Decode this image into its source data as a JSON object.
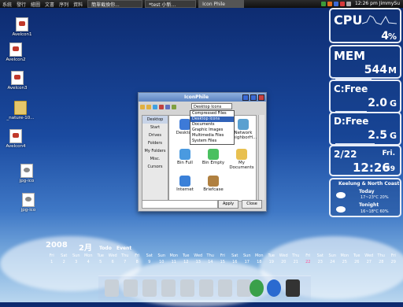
{
  "taskbar": {
    "menus": [
      "系統",
      "發行",
      "繪圖",
      "文書",
      "序列",
      "資料"
    ],
    "tasks": [
      "簡單截換你...",
      "*test 小新...",
      "Icon Phile"
    ],
    "clock": "12:26 pm JimmySu"
  },
  "desktop_icons": [
    "AveIcon1",
    "AveIcon2",
    "AveIcon3",
    "_nature-10...",
    "AveIcon4",
    "jpg-ico",
    "jpg-ico"
  ],
  "widgets": {
    "cpu": {
      "label": "CPU",
      "value": "4",
      "unit": "%"
    },
    "mem": {
      "label": "MEM",
      "value": "544",
      "unit": "M"
    },
    "c_free": {
      "label": "C:Free",
      "value": "2.0",
      "unit": "G"
    },
    "d_free": {
      "label": "D:Free",
      "value": "2.5",
      "unit": "G"
    },
    "date": {
      "date": "2/22",
      "weekday": "Fri.",
      "time": "12:26",
      "seconds": "59"
    },
    "weather": {
      "location": "Keelung & North Coast",
      "today_label": "Today",
      "today_temp": "17~23°C 20%",
      "tonight_label": "Tonight",
      "tonight_temp": "16~18°C 60%"
    }
  },
  "window": {
    "title": "IconPhile",
    "dropdown_value": "Desktop Icons",
    "menu_items": [
      "Compressed Files",
      "Desktop Icons",
      "Documents",
      "Graphic Images",
      "Multimedia Files",
      "System Files"
    ],
    "sidebar": [
      "Desktop",
      "Start",
      "Drives",
      "Folders",
      "My Folders",
      "Misc.",
      "Cursors"
    ],
    "files": [
      "Desktop",
      "Network NeighborH...",
      "Bin Full",
      "Bin Empty",
      "My Documents",
      "Internet",
      "Briefcase"
    ],
    "apply_label": "Apply",
    "close_label": "Close"
  },
  "calendar": {
    "year": "2008",
    "month": "2月",
    "todo": "Todo",
    "event": "Event",
    "days": [
      "Fri",
      "Sat",
      "Sun",
      "Mon",
      "Tue",
      "Wed",
      "Thu",
      "Fri",
      "Sat",
      "Sun",
      "Mon",
      "Tue",
      "Wed",
      "Thu",
      "Fri",
      "Sat",
      "Sun",
      "Mon",
      "Tue",
      "Wed",
      "Thu",
      "Fri",
      "Sat",
      "Sun",
      "Mon",
      "Tue",
      "Wed",
      "Thu",
      "Fri"
    ],
    "dates": [
      "1",
      "2",
      "3",
      "4",
      "5",
      "6",
      "7",
      "8",
      "9",
      "10",
      "11",
      "12",
      "13",
      "14",
      "15",
      "16",
      "17",
      "18",
      "19",
      "20",
      "21",
      "22",
      "23",
      "24",
      "25",
      "26",
      "27",
      "28",
      "29"
    ],
    "highlight": "22"
  }
}
